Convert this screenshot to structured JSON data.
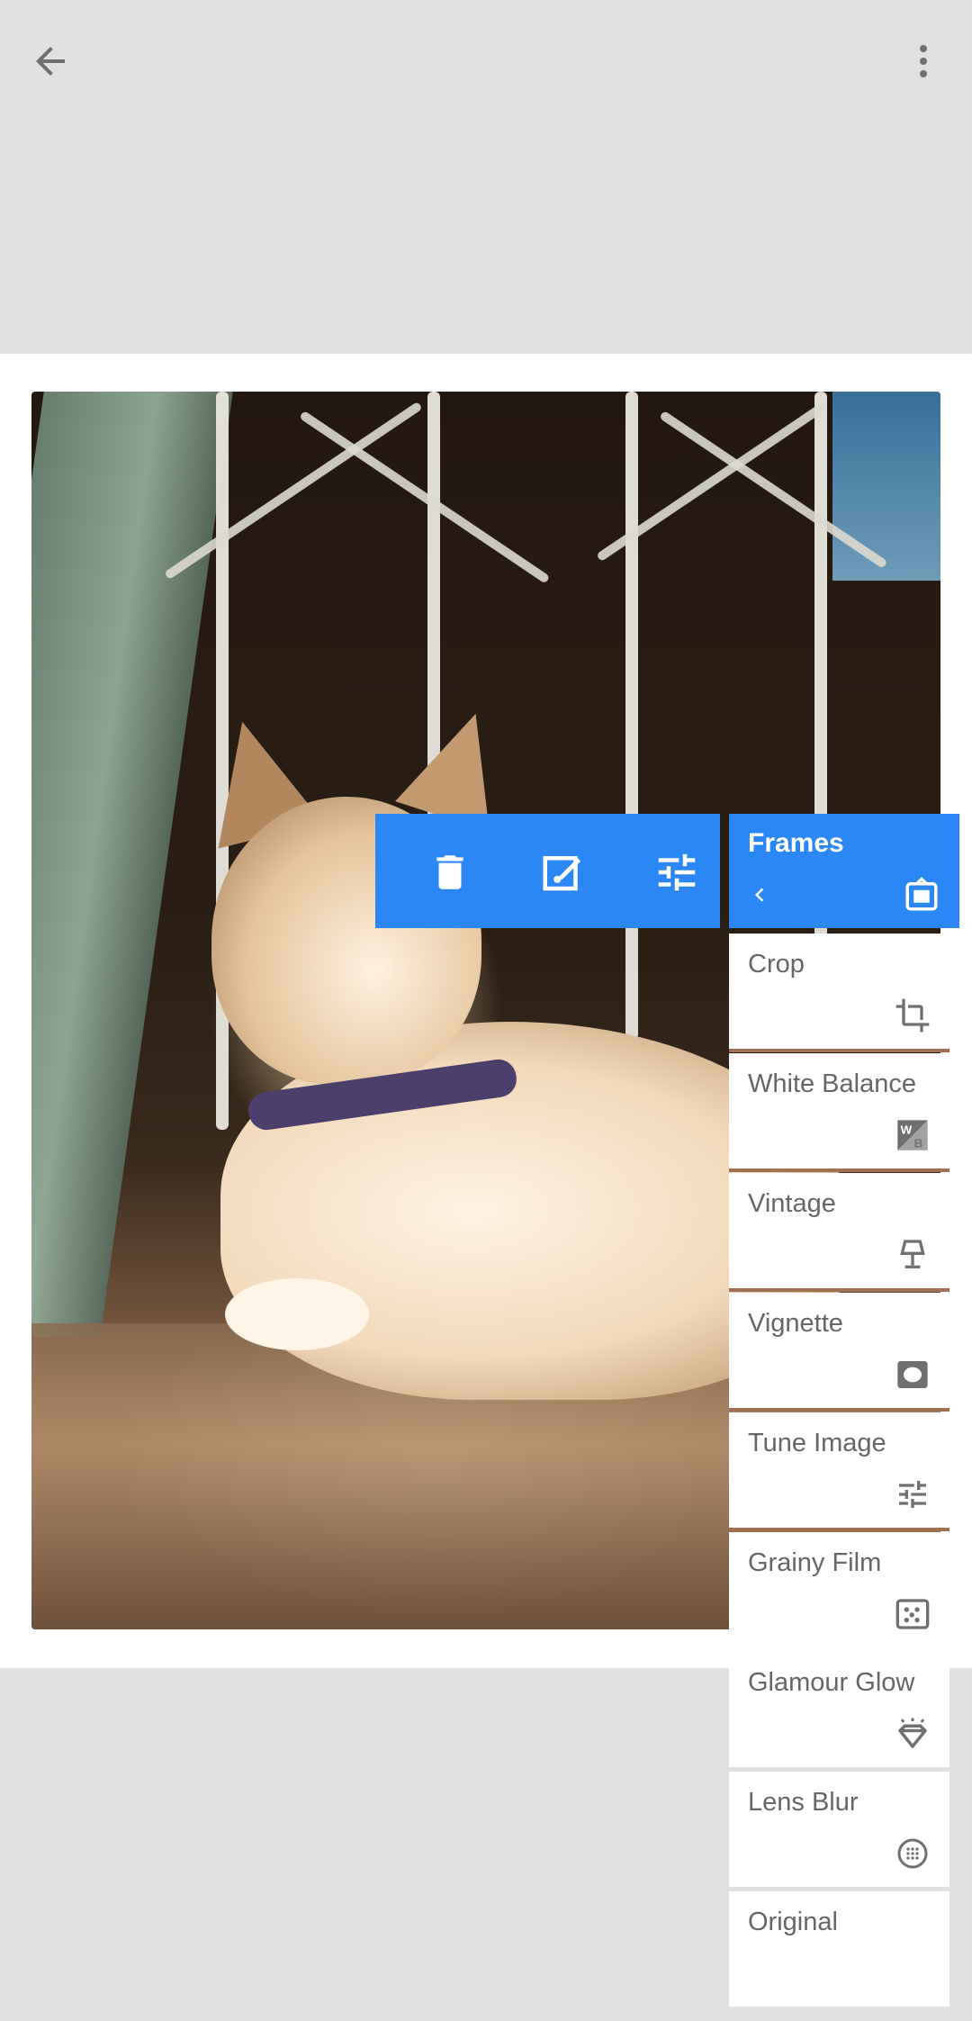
{
  "colors": {
    "accent": "#2a87f5",
    "panel_bg": "#ffffff",
    "canvas_bg": "#e0e0e0",
    "label": "#666666"
  },
  "topbar": {
    "back_icon": "arrow-back-icon",
    "more_icon": "more-vert-icon"
  },
  "toolbar": {
    "icons": [
      "trash-icon",
      "edit-icon",
      "tune-sliders-icon"
    ]
  },
  "stack": {
    "header": {
      "title": "Frames",
      "chevron_icon": "chevron-left-icon",
      "icon": "frames-icon"
    },
    "items": [
      {
        "label": "Crop",
        "icon": "crop-icon"
      },
      {
        "label": "White Balance",
        "icon": "white-balance-icon"
      },
      {
        "label": "Vintage",
        "icon": "lamp-icon"
      },
      {
        "label": "Vignette",
        "icon": "vignette-icon"
      },
      {
        "label": "Tune Image",
        "icon": "tune-sliders-icon"
      },
      {
        "label": "Grainy Film",
        "icon": "grain-icon"
      },
      {
        "label": "Glamour Glow",
        "icon": "diamond-icon"
      },
      {
        "label": "Lens Blur",
        "icon": "lens-blur-icon"
      },
      {
        "label": "Original",
        "icon": ""
      }
    ]
  }
}
